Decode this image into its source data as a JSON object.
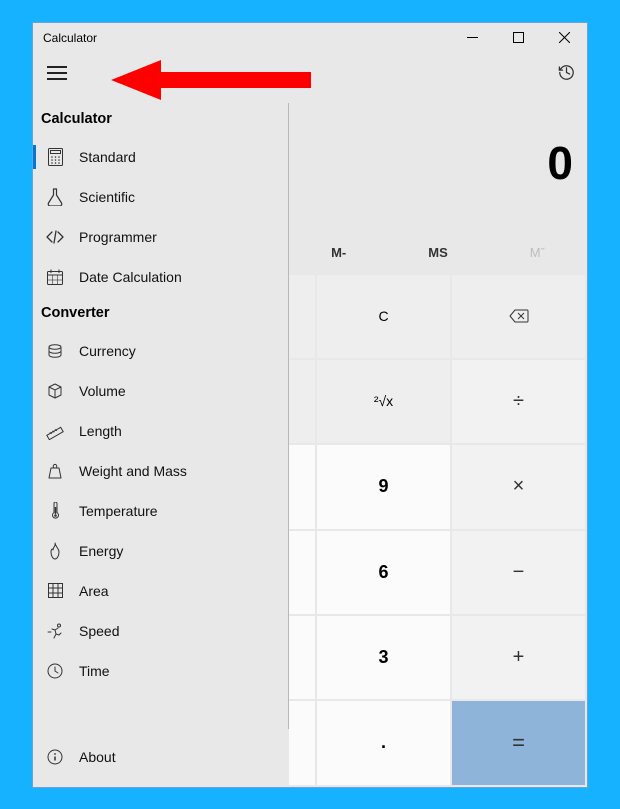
{
  "window": {
    "title": "Calculator"
  },
  "display": {
    "value": "0"
  },
  "memory": {
    "mminus": "M-",
    "ms": "MS",
    "mrest": "Mˇ"
  },
  "sidebar": {
    "section_calc": "Calculator",
    "section_conv": "Converter",
    "calc_items": [
      {
        "label": "Standard"
      },
      {
        "label": "Scientific"
      },
      {
        "label": "Programmer"
      },
      {
        "label": "Date Calculation"
      }
    ],
    "conv_items": [
      {
        "label": "Currency"
      },
      {
        "label": "Volume"
      },
      {
        "label": "Length"
      },
      {
        "label": "Weight and Mass"
      },
      {
        "label": "Temperature"
      },
      {
        "label": "Energy"
      },
      {
        "label": "Area"
      },
      {
        "label": "Speed"
      },
      {
        "label": "Time"
      }
    ],
    "about": "About"
  },
  "keys": {
    "c": "C",
    "root": "²√x",
    "nine": "9",
    "six": "6",
    "three": "3",
    "dot": ".",
    "div": "÷",
    "mul": "×",
    "sub": "−",
    "add": "+",
    "eq": "="
  }
}
